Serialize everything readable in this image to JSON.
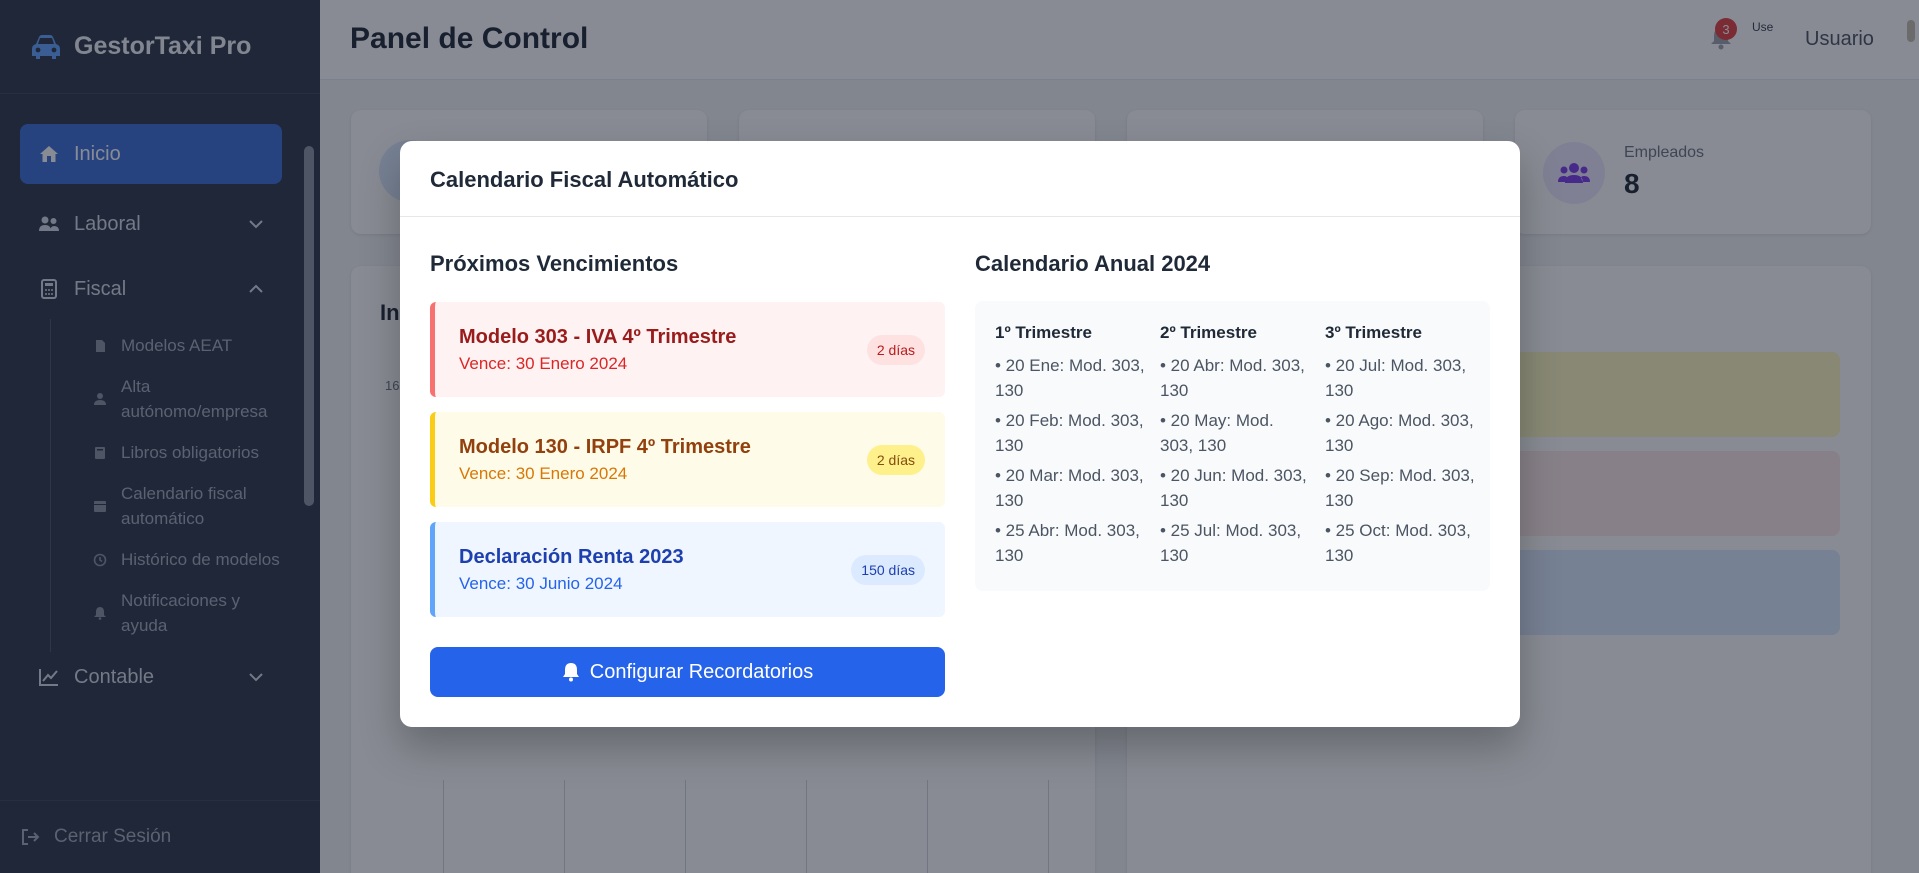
{
  "sidebar": {
    "brand": "GestorTaxi Pro",
    "items": [
      {
        "label": "Inicio"
      },
      {
        "label": "Laboral"
      },
      {
        "label": "Fiscal"
      },
      {
        "label": "Contable"
      }
    ],
    "fiscal_sub": [
      {
        "label": "Modelos AEAT"
      },
      {
        "label": "Alta autónomo/empresa"
      },
      {
        "label": "Libros obligatorios"
      },
      {
        "label": "Calendario fiscal automático"
      },
      {
        "label": "Histórico de modelos"
      },
      {
        "label": "Notificaciones y ayuda"
      }
    ],
    "logout": "Cerrar Sesión"
  },
  "header": {
    "title": "Panel de Control",
    "notifications_count": "3",
    "avatar_alt": "Use",
    "username": "Usuario"
  },
  "background": {
    "employees_label": "Empleados",
    "employees_value": "8",
    "chart_title_partial": "In",
    "chart_tick_partial": "16"
  },
  "modal": {
    "title": "Calendario Fiscal Automático",
    "upcoming_title": "Próximos Vencimientos",
    "due_items": [
      {
        "name": "Modelo 303 - IVA 4º Trimestre",
        "date": "Vence: 30 Enero 2024",
        "days": "2 días",
        "color": "#ef4444"
      },
      {
        "name": "Modelo 130 - IRPF 4º Trimestre",
        "date": "Vence: 30 Enero 2024",
        "days": "2 días",
        "color": "#eab308"
      },
      {
        "name": "Declaración Renta 2023",
        "date": "Vence: 30 Junio 2024",
        "days": "150 días",
        "color": "#3b82f6"
      }
    ],
    "configure_button": "Configurar Recordatorios",
    "annual_title": "Calendario Anual 2024",
    "quarters": [
      {
        "title": "1º Trimestre",
        "lines": [
          "• 20 Ene: Mod. 303, 130",
          "• 20 Feb: Mod. 303, 130",
          "• 20 Mar: Mod. 303, 130",
          "• 25 Abr: Mod. 303, 130"
        ]
      },
      {
        "title": "2º Trimestre",
        "lines": [
          "• 20 Abr: Mod. 303, 130",
          "• 20 May: Mod. 303, 130",
          "• 20 Jun: Mod. 303, 130",
          "• 25 Jul: Mod. 303, 130"
        ]
      },
      {
        "title": "3º Trimestre",
        "lines": [
          "• 20 Jul: Mod. 303, 130",
          "• 20 Ago: Mod. 303, 130",
          "• 20 Sep: Mod. 303, 130",
          "• 25 Oct: Mod. 303, 130"
        ]
      }
    ]
  }
}
